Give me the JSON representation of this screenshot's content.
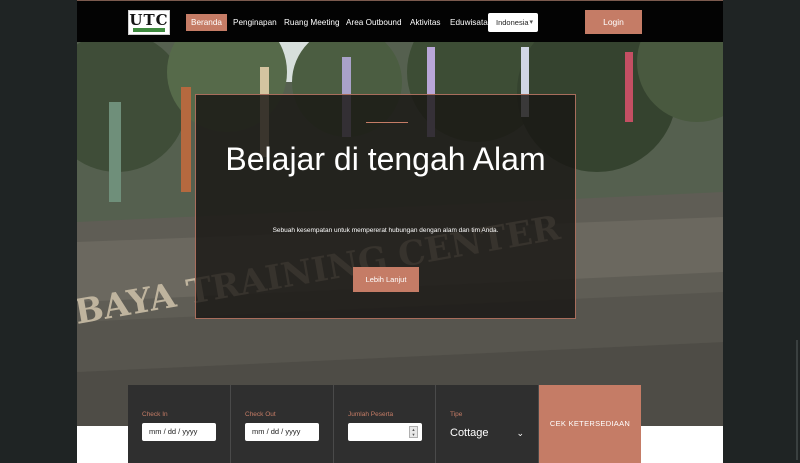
{
  "brand": {
    "logo_text": "UTC"
  },
  "nav": {
    "items": [
      {
        "label": "Beranda",
        "active": true
      },
      {
        "label": "Penginapan",
        "active": false
      },
      {
        "label": "Ruang Meeting",
        "active": false
      },
      {
        "label": "Area Outbound",
        "active": false
      },
      {
        "label": "Aktivitas",
        "active": false
      },
      {
        "label": "Eduwisata",
        "active": false
      }
    ],
    "language": "Indonesia",
    "login_label": "Login"
  },
  "hero": {
    "title": "Belajar di tengah Alam",
    "subtitle": "Sebuah kesempatan untuk mempererat hubungan dengan alam dan tim Anda.",
    "button_label": "Lebih Lanjut",
    "background_text": "BAYA TRAINING CENTER"
  },
  "booking": {
    "check_in_label": "Check In",
    "check_in_value": "mm / dd / yyyy",
    "check_out_label": "Check Out",
    "check_out_value": "mm / dd / yyyy",
    "guests_label": "Jumlah Peserta",
    "guests_value": "",
    "type_label": "Tipe",
    "type_value": "Cottage",
    "submit_label": "CEK KETERSEDIAAN"
  },
  "colors": {
    "accent": "#c57c66",
    "nav_bg": "#030303",
    "panel_bg": "#2f2f2f"
  }
}
